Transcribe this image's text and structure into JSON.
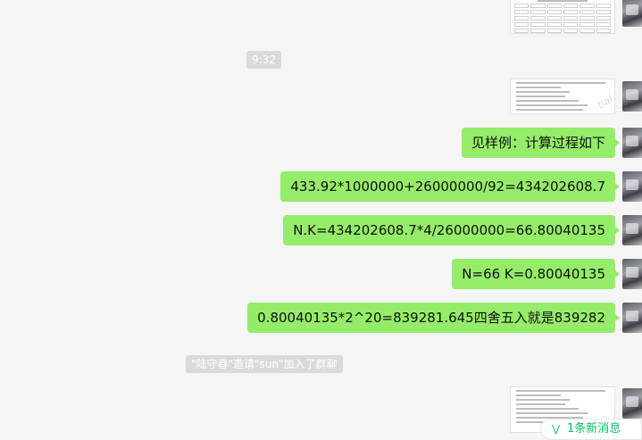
{
  "time_divider": "9:32",
  "messages": [
    {
      "text": "见样例：计算过程如下"
    },
    {
      "text": "433.92*1000000+26000000/92=434202608.7"
    },
    {
      "text": "N.K=434202608.7*4/26000000=66.80040135"
    },
    {
      "text": "N=66 K=0.80040135"
    },
    {
      "text": "0.80040135*2^20=839281.645四舍五入就是839282"
    }
  ],
  "system_notice": "\"陆守春\"邀请\"sun\"加入了群聊",
  "new_message_pill": {
    "icon": "double-chevron-down-icon",
    "label": "1条新消息"
  },
  "image_watermark": "tial"
}
